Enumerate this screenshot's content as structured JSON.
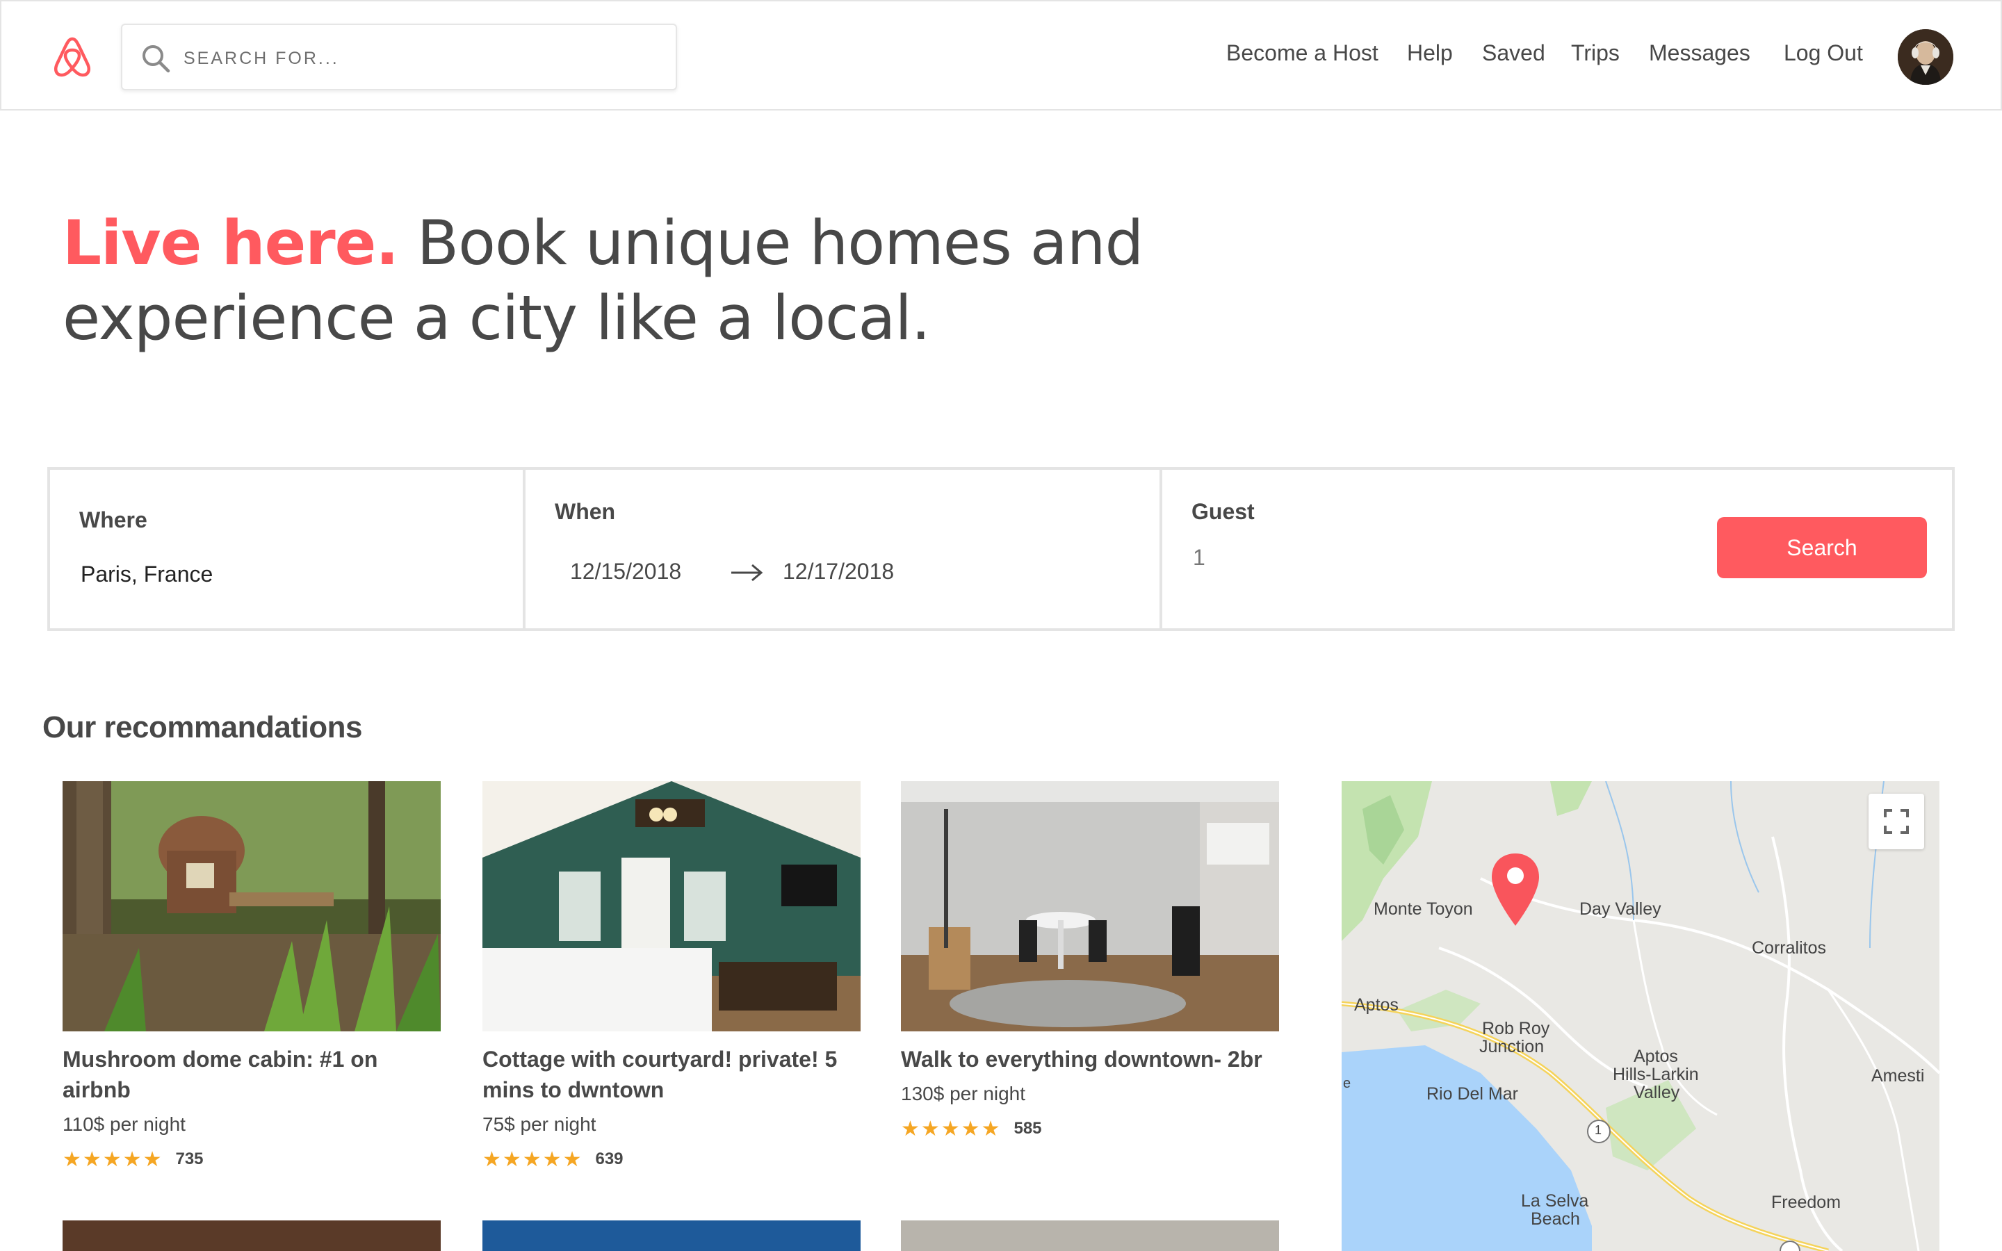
{
  "header": {
    "search_placeholder": "SEARCH FOR...",
    "nav": [
      "Become a Host",
      "Help",
      "Saved",
      "Trips",
      "Messages",
      "Log Out"
    ]
  },
  "hero": {
    "accent": "Live here.",
    "line1": " Book unique homes and",
    "line2": "experience a city like a local."
  },
  "booking": {
    "where_label": "Where",
    "where_value": "Paris, France",
    "when_label": "When",
    "check_in": "12/15/2018",
    "check_out": "12/17/2018",
    "guest_label": "Guest",
    "guest_value": "1",
    "search_label": "Search"
  },
  "recommendations": {
    "title": "Our recommandations",
    "cards": [
      {
        "title": "Mushroom dome cabin: #1 on airbnb",
        "price": "110$ per night",
        "stars": "★★★★★",
        "reviews": "735"
      },
      {
        "title": "Cottage with courtyard! private! 5 mins to dwntown",
        "price": "75$ per night",
        "stars": "★★★★★",
        "reviews": "639"
      },
      {
        "title": "Walk to everything downtown- 2br",
        "price": "130$ per night",
        "stars": "★★★★★",
        "reviews": "585"
      }
    ]
  },
  "map": {
    "labels": [
      "Monte Toyon",
      "Day Valley",
      "Corralitos",
      "Aptos",
      "Rob Roy",
      "Junction",
      "Aptos",
      "Hills-Larkin",
      "Valley",
      "Amesti",
      "Rio Del Mar",
      "La Selva",
      "Beach",
      "Freedom",
      "1",
      "e"
    ]
  },
  "colors": {
    "accent": "#ff5a5f",
    "star": "#f5a623",
    "text": "#484848"
  }
}
